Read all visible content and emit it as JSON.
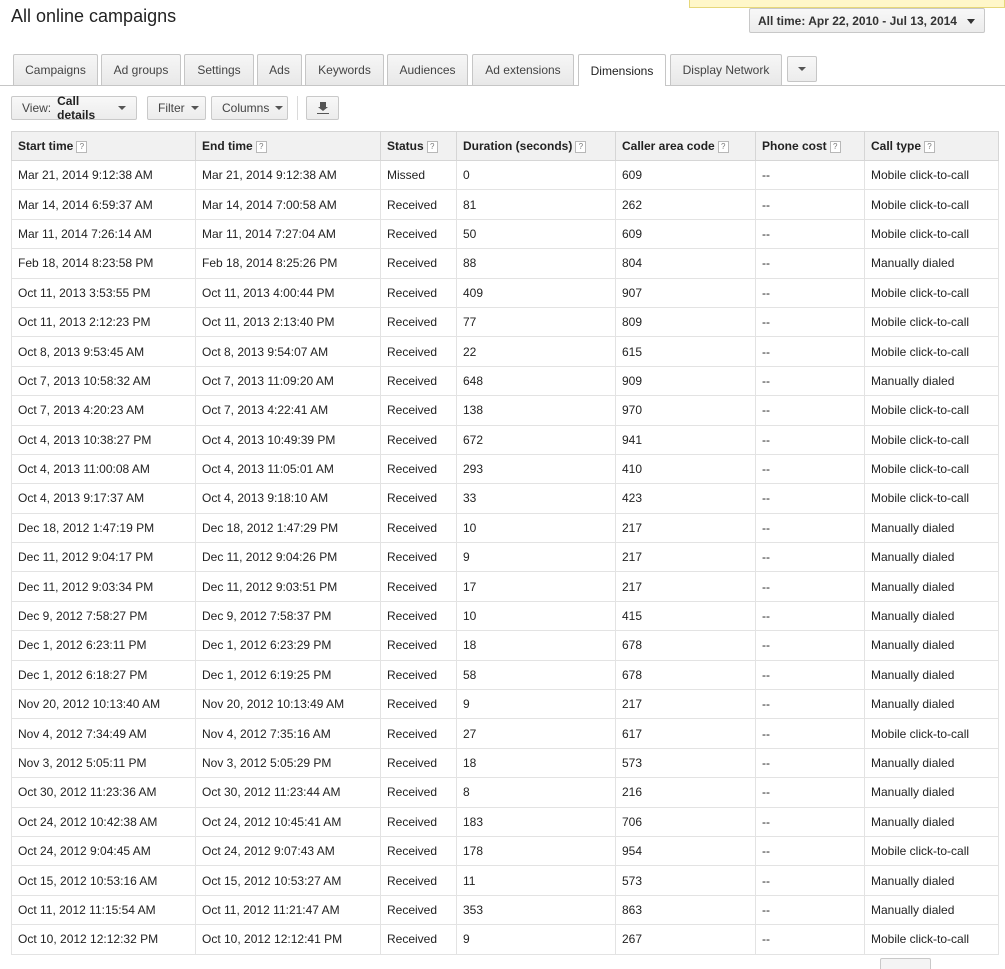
{
  "header": {
    "title": "All online campaigns",
    "date_range": "All time: Apr 22, 2010 - Jul 13, 2014"
  },
  "tabs": [
    {
      "label": "Campaigns"
    },
    {
      "label": "Ad groups"
    },
    {
      "label": "Settings"
    },
    {
      "label": "Ads"
    },
    {
      "label": "Keywords"
    },
    {
      "label": "Audiences"
    },
    {
      "label": "Ad extensions"
    },
    {
      "label": "Dimensions",
      "active": true
    },
    {
      "label": "Display Network"
    }
  ],
  "toolbar": {
    "view_prefix": "View:",
    "view_value": "Call details",
    "filter_label": "Filter",
    "columns_label": "Columns",
    "download_icon": "download-icon"
  },
  "table": {
    "help_glyph": "?",
    "columns": [
      "Start time",
      "End time",
      "Status",
      "Duration (seconds)",
      "Caller area code",
      "Phone cost",
      "Call type"
    ],
    "rows": [
      [
        "Mar 21, 2014 9:12:38 AM",
        "Mar 21, 2014 9:12:38 AM",
        "Missed",
        "0",
        "609",
        "--",
        "Mobile click-to-call"
      ],
      [
        "Mar 14, 2014 6:59:37 AM",
        "Mar 14, 2014 7:00:58 AM",
        "Received",
        "81",
        "262",
        "--",
        "Mobile click-to-call"
      ],
      [
        "Mar 11, 2014 7:26:14 AM",
        "Mar 11, 2014 7:27:04 AM",
        "Received",
        "50",
        "609",
        "--",
        "Mobile click-to-call"
      ],
      [
        "Feb 18, 2014 8:23:58 PM",
        "Feb 18, 2014 8:25:26 PM",
        "Received",
        "88",
        "804",
        "--",
        "Manually dialed"
      ],
      [
        "Oct 11, 2013 3:53:55 PM",
        "Oct 11, 2013 4:00:44 PM",
        "Received",
        "409",
        "907",
        "--",
        "Mobile click-to-call"
      ],
      [
        "Oct 11, 2013 2:12:23 PM",
        "Oct 11, 2013 2:13:40 PM",
        "Received",
        "77",
        "809",
        "--",
        "Mobile click-to-call"
      ],
      [
        "Oct 8, 2013 9:53:45 AM",
        "Oct 8, 2013 9:54:07 AM",
        "Received",
        "22",
        "615",
        "--",
        "Mobile click-to-call"
      ],
      [
        "Oct 7, 2013 10:58:32 AM",
        "Oct 7, 2013 11:09:20 AM",
        "Received",
        "648",
        "909",
        "--",
        "Manually dialed"
      ],
      [
        "Oct 7, 2013 4:20:23 AM",
        "Oct 7, 2013 4:22:41 AM",
        "Received",
        "138",
        "970",
        "--",
        "Mobile click-to-call"
      ],
      [
        "Oct 4, 2013 10:38:27 PM",
        "Oct 4, 2013 10:49:39 PM",
        "Received",
        "672",
        "941",
        "--",
        "Mobile click-to-call"
      ],
      [
        "Oct 4, 2013 11:00:08 AM",
        "Oct 4, 2013 11:05:01 AM",
        "Received",
        "293",
        "410",
        "--",
        "Mobile click-to-call"
      ],
      [
        "Oct 4, 2013 9:17:37 AM",
        "Oct 4, 2013 9:18:10 AM",
        "Received",
        "33",
        "423",
        "--",
        "Mobile click-to-call"
      ],
      [
        "Dec 18, 2012 1:47:19 PM",
        "Dec 18, 2012 1:47:29 PM",
        "Received",
        "10",
        "217",
        "--",
        "Manually dialed"
      ],
      [
        "Dec 11, 2012 9:04:17 PM",
        "Dec 11, 2012 9:04:26 PM",
        "Received",
        "9",
        "217",
        "--",
        "Manually dialed"
      ],
      [
        "Dec 11, 2012 9:03:34 PM",
        "Dec 11, 2012 9:03:51 PM",
        "Received",
        "17",
        "217",
        "--",
        "Manually dialed"
      ],
      [
        "Dec 9, 2012 7:58:27 PM",
        "Dec 9, 2012 7:58:37 PM",
        "Received",
        "10",
        "415",
        "--",
        "Manually dialed"
      ],
      [
        "Dec 1, 2012 6:23:11 PM",
        "Dec 1, 2012 6:23:29 PM",
        "Received",
        "18",
        "678",
        "--",
        "Manually dialed"
      ],
      [
        "Dec 1, 2012 6:18:27 PM",
        "Dec 1, 2012 6:19:25 PM",
        "Received",
        "58",
        "678",
        "--",
        "Manually dialed"
      ],
      [
        "Nov 20, 2012 10:13:40 AM",
        "Nov 20, 2012 10:13:49 AM",
        "Received",
        "9",
        "217",
        "--",
        "Manually dialed"
      ],
      [
        "Nov 4, 2012 7:34:49 AM",
        "Nov 4, 2012 7:35:16 AM",
        "Received",
        "27",
        "617",
        "--",
        "Mobile click-to-call"
      ],
      [
        "Nov 3, 2012 5:05:11 PM",
        "Nov 3, 2012 5:05:29 PM",
        "Received",
        "18",
        "573",
        "--",
        "Manually dialed"
      ],
      [
        "Oct 30, 2012 11:23:36 AM",
        "Oct 30, 2012 11:23:44 AM",
        "Received",
        "8",
        "216",
        "--",
        "Manually dialed"
      ],
      [
        "Oct 24, 2012 10:42:38 AM",
        "Oct 24, 2012 10:45:41 AM",
        "Received",
        "183",
        "706",
        "--",
        "Manually dialed"
      ],
      [
        "Oct 24, 2012 9:04:45 AM",
        "Oct 24, 2012 9:07:43 AM",
        "Received",
        "178",
        "954",
        "--",
        "Mobile click-to-call"
      ],
      [
        "Oct 15, 2012 10:53:16 AM",
        "Oct 15, 2012 10:53:27 AM",
        "Received",
        "11",
        "573",
        "--",
        "Manually dialed"
      ],
      [
        "Oct 11, 2012 11:15:54 AM",
        "Oct 11, 2012 11:21:47 AM",
        "Received",
        "353",
        "863",
        "--",
        "Manually dialed"
      ],
      [
        "Oct 10, 2012 12:12:32 PM",
        "Oct 10, 2012 12:12:41 PM",
        "Received",
        "9",
        "267",
        "--",
        "Mobile click-to-call"
      ]
    ]
  }
}
